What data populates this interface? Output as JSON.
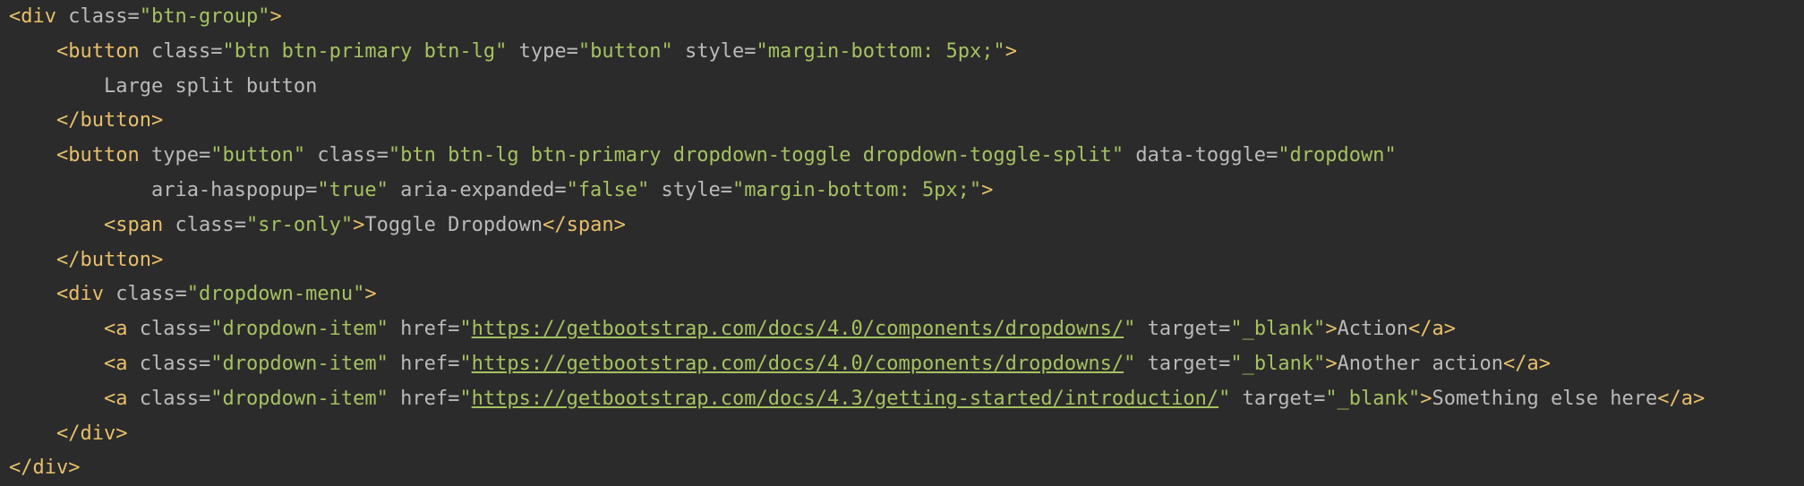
{
  "editor": {
    "lines": [
      {
        "indent": 0,
        "tokens": [
          {
            "t": "punct",
            "v": "<"
          },
          {
            "t": "tag",
            "v": "div"
          },
          {
            "t": "space",
            "v": " "
          },
          {
            "t": "attr",
            "v": "class"
          },
          {
            "t": "eq",
            "v": "="
          },
          {
            "t": "val",
            "v": "\"btn-group\""
          },
          {
            "t": "punct",
            "v": ">"
          }
        ]
      },
      {
        "indent": 4,
        "tokens": [
          {
            "t": "punct",
            "v": "<"
          },
          {
            "t": "tag",
            "v": "button"
          },
          {
            "t": "space",
            "v": " "
          },
          {
            "t": "attr",
            "v": "class"
          },
          {
            "t": "eq",
            "v": "="
          },
          {
            "t": "val",
            "v": "\"btn btn-primary btn-lg\""
          },
          {
            "t": "space",
            "v": " "
          },
          {
            "t": "attr",
            "v": "type"
          },
          {
            "t": "eq",
            "v": "="
          },
          {
            "t": "val",
            "v": "\"button\""
          },
          {
            "t": "space",
            "v": " "
          },
          {
            "t": "attr",
            "v": "style"
          },
          {
            "t": "eq",
            "v": "="
          },
          {
            "t": "val",
            "v": "\"margin-bottom: 5px;\""
          },
          {
            "t": "punct",
            "v": ">"
          }
        ]
      },
      {
        "indent": 8,
        "tokens": [
          {
            "t": "text",
            "v": "Large split button"
          }
        ]
      },
      {
        "indent": 4,
        "tokens": [
          {
            "t": "punct",
            "v": "</"
          },
          {
            "t": "tag",
            "v": "button"
          },
          {
            "t": "punct",
            "v": ">"
          }
        ]
      },
      {
        "indent": 4,
        "tokens": [
          {
            "t": "punct",
            "v": "<"
          },
          {
            "t": "tag",
            "v": "button"
          },
          {
            "t": "space",
            "v": " "
          },
          {
            "t": "attr",
            "v": "type"
          },
          {
            "t": "eq",
            "v": "="
          },
          {
            "t": "val",
            "v": "\"button\""
          },
          {
            "t": "space",
            "v": " "
          },
          {
            "t": "attr",
            "v": "class"
          },
          {
            "t": "eq",
            "v": "="
          },
          {
            "t": "val",
            "v": "\"btn btn-lg btn-primary dropdown-toggle dropdown-toggle-split\""
          },
          {
            "t": "space",
            "v": " "
          },
          {
            "t": "attr",
            "v": "data-toggle"
          },
          {
            "t": "eq",
            "v": "="
          },
          {
            "t": "val",
            "v": "\"dropdown\""
          }
        ]
      },
      {
        "indent": 12,
        "tokens": [
          {
            "t": "attr",
            "v": "aria-haspopup"
          },
          {
            "t": "eq",
            "v": "="
          },
          {
            "t": "val",
            "v": "\"true\""
          },
          {
            "t": "space",
            "v": " "
          },
          {
            "t": "attr",
            "v": "aria-expanded"
          },
          {
            "t": "eq",
            "v": "="
          },
          {
            "t": "val",
            "v": "\"false\""
          },
          {
            "t": "space",
            "v": " "
          },
          {
            "t": "attr",
            "v": "style"
          },
          {
            "t": "eq",
            "v": "="
          },
          {
            "t": "val",
            "v": "\"margin-bottom: 5px;\""
          },
          {
            "t": "punct",
            "v": ">"
          }
        ]
      },
      {
        "indent": 8,
        "tokens": [
          {
            "t": "punct",
            "v": "<"
          },
          {
            "t": "tag",
            "v": "span"
          },
          {
            "t": "space",
            "v": " "
          },
          {
            "t": "attr",
            "v": "class"
          },
          {
            "t": "eq",
            "v": "="
          },
          {
            "t": "val",
            "v": "\"sr-only\""
          },
          {
            "t": "punct",
            "v": ">"
          },
          {
            "t": "text",
            "v": "Toggle Dropdown"
          },
          {
            "t": "punct",
            "v": "</"
          },
          {
            "t": "tag",
            "v": "span"
          },
          {
            "t": "punct",
            "v": ">"
          }
        ]
      },
      {
        "indent": 4,
        "tokens": [
          {
            "t": "punct",
            "v": "</"
          },
          {
            "t": "tag",
            "v": "button"
          },
          {
            "t": "punct",
            "v": ">"
          }
        ]
      },
      {
        "indent": 4,
        "tokens": [
          {
            "t": "punct",
            "v": "<"
          },
          {
            "t": "tag",
            "v": "div"
          },
          {
            "t": "space",
            "v": " "
          },
          {
            "t": "attr",
            "v": "class"
          },
          {
            "t": "eq",
            "v": "="
          },
          {
            "t": "val",
            "v": "\"dropdown-menu\""
          },
          {
            "t": "punct",
            "v": ">"
          }
        ]
      },
      {
        "indent": 8,
        "tokens": [
          {
            "t": "punct",
            "v": "<"
          },
          {
            "t": "tag",
            "v": "a"
          },
          {
            "t": "space",
            "v": " "
          },
          {
            "t": "attr",
            "v": "class"
          },
          {
            "t": "eq",
            "v": "="
          },
          {
            "t": "val",
            "v": "\"dropdown-item\""
          },
          {
            "t": "space",
            "v": " "
          },
          {
            "t": "attr",
            "v": "href"
          },
          {
            "t": "eq",
            "v": "="
          },
          {
            "t": "val",
            "v": "\""
          },
          {
            "t": "url",
            "v": "https://getbootstrap.com/docs/4.0/components/dropdowns/"
          },
          {
            "t": "val",
            "v": "\""
          },
          {
            "t": "space",
            "v": " "
          },
          {
            "t": "attr",
            "v": "target"
          },
          {
            "t": "eq",
            "v": "="
          },
          {
            "t": "val",
            "v": "\"_blank\""
          },
          {
            "t": "punct",
            "v": ">"
          },
          {
            "t": "text",
            "v": "Action"
          },
          {
            "t": "punct",
            "v": "</"
          },
          {
            "t": "tag",
            "v": "a"
          },
          {
            "t": "punct",
            "v": ">"
          }
        ]
      },
      {
        "indent": 8,
        "tokens": [
          {
            "t": "punct",
            "v": "<"
          },
          {
            "t": "tag",
            "v": "a"
          },
          {
            "t": "space",
            "v": " "
          },
          {
            "t": "attr",
            "v": "class"
          },
          {
            "t": "eq",
            "v": "="
          },
          {
            "t": "val",
            "v": "\"dropdown-item\""
          },
          {
            "t": "space",
            "v": " "
          },
          {
            "t": "attr",
            "v": "href"
          },
          {
            "t": "eq",
            "v": "="
          },
          {
            "t": "val",
            "v": "\""
          },
          {
            "t": "url",
            "v": "https://getbootstrap.com/docs/4.0/components/dropdowns/"
          },
          {
            "t": "val",
            "v": "\""
          },
          {
            "t": "space",
            "v": " "
          },
          {
            "t": "attr",
            "v": "target"
          },
          {
            "t": "eq",
            "v": "="
          },
          {
            "t": "val",
            "v": "\"_blank\""
          },
          {
            "t": "punct",
            "v": ">"
          },
          {
            "t": "text",
            "v": "Another action"
          },
          {
            "t": "punct",
            "v": "</"
          },
          {
            "t": "tag",
            "v": "a"
          },
          {
            "t": "punct",
            "v": ">"
          }
        ]
      },
      {
        "indent": 8,
        "tokens": [
          {
            "t": "punct",
            "v": "<"
          },
          {
            "t": "tag",
            "v": "a"
          },
          {
            "t": "space",
            "v": " "
          },
          {
            "t": "attr",
            "v": "class"
          },
          {
            "t": "eq",
            "v": "="
          },
          {
            "t": "val",
            "v": "\"dropdown-item\""
          },
          {
            "t": "space",
            "v": " "
          },
          {
            "t": "attr",
            "v": "href"
          },
          {
            "t": "eq",
            "v": "="
          },
          {
            "t": "val",
            "v": "\""
          },
          {
            "t": "url",
            "v": "https://getbootstrap.com/docs/4.3/getting-started/introduction/"
          },
          {
            "t": "val",
            "v": "\""
          },
          {
            "t": "space",
            "v": " "
          },
          {
            "t": "attr",
            "v": "target"
          },
          {
            "t": "eq",
            "v": "="
          },
          {
            "t": "val",
            "v": "\"_blank\""
          },
          {
            "t": "punct",
            "v": ">"
          },
          {
            "t": "text",
            "v": "Something else here"
          },
          {
            "t": "punct",
            "v": "</"
          },
          {
            "t": "tag",
            "v": "a"
          },
          {
            "t": "punct",
            "v": ">"
          }
        ]
      },
      {
        "indent": 4,
        "tokens": [
          {
            "t": "punct",
            "v": "</"
          },
          {
            "t": "tag",
            "v": "div"
          },
          {
            "t": "punct",
            "v": ">"
          }
        ]
      },
      {
        "indent": 0,
        "tokens": [
          {
            "t": "punct",
            "v": "</"
          },
          {
            "t": "tag",
            "v": "div"
          },
          {
            "t": "punct",
            "v": ">"
          }
        ]
      }
    ]
  }
}
